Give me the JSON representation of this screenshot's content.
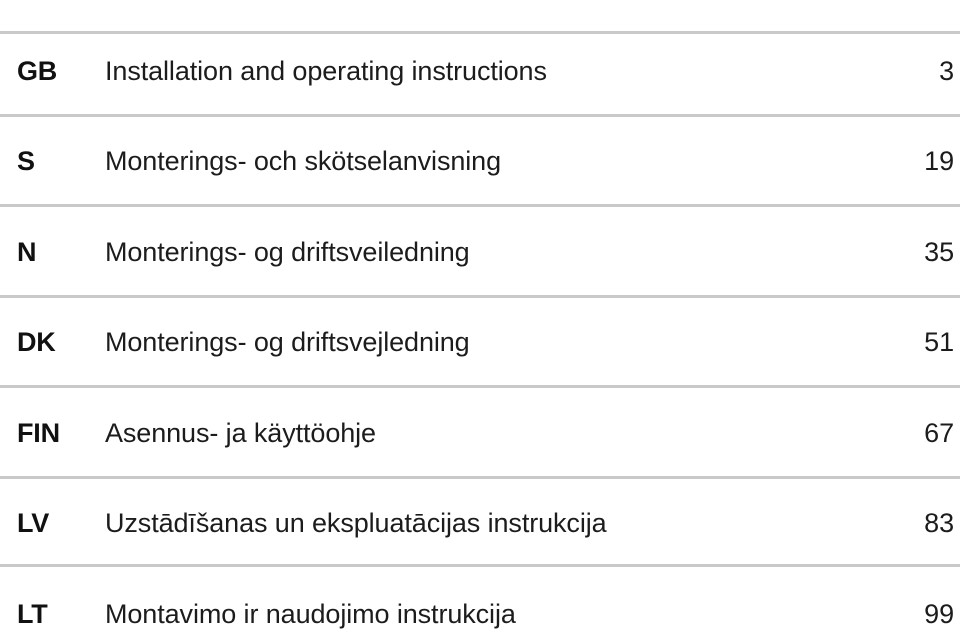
{
  "document": {
    "type": "table-of-contents",
    "rule_color": "#c9c9c9",
    "text_color": "#1c1c1c",
    "entries": [
      {
        "lang_code": "GB",
        "title": "Installation and operating instructions",
        "page": "3"
      },
      {
        "lang_code": "S",
        "title": "Monterings- och skötselanvisning",
        "page": "19"
      },
      {
        "lang_code": "N",
        "title": "Monterings- og driftsveiledning",
        "page": "35"
      },
      {
        "lang_code": "DK",
        "title": "Monterings- og driftsvejledning",
        "page": "51"
      },
      {
        "lang_code": "FIN",
        "title": "Asennus- ja käyttöohje",
        "page": "67"
      },
      {
        "lang_code": "LV",
        "title": "Uzstādīšanas un ekspluatācijas instrukcija",
        "page": "83"
      },
      {
        "lang_code": "LT",
        "title": "Montavimo ir naudojimo instrukcija",
        "page": "99"
      }
    ]
  }
}
